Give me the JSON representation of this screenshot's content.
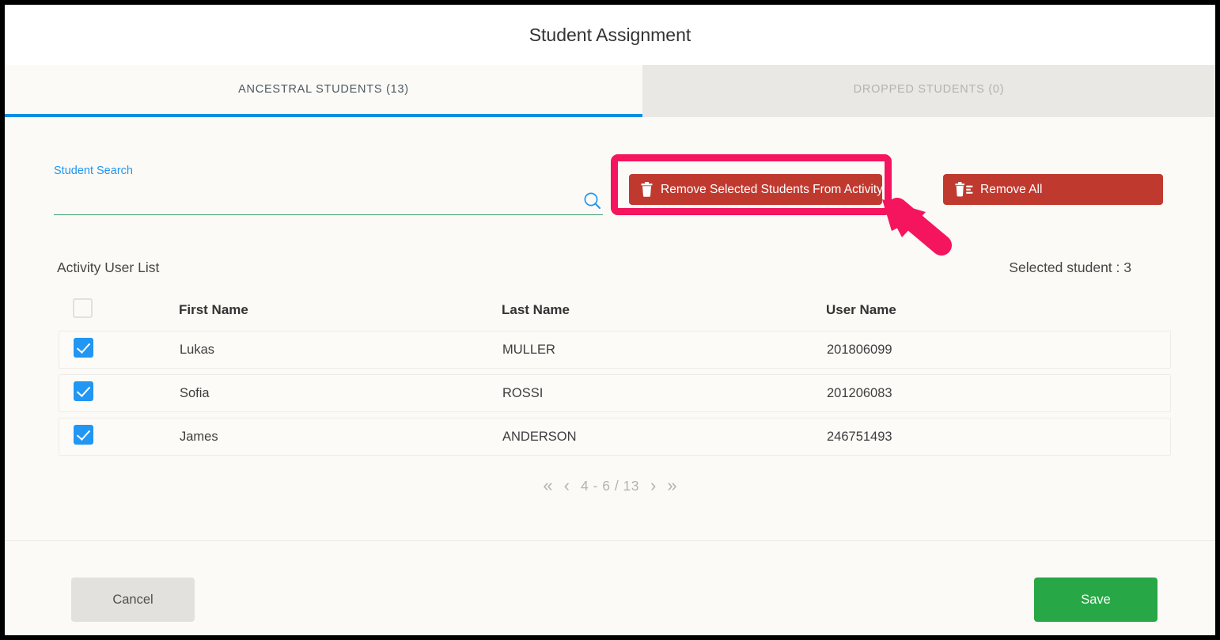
{
  "modal": {
    "title": "Student Assignment"
  },
  "tabs": [
    {
      "label": "ANCESTRAL STUDENTS (13)",
      "active": true
    },
    {
      "label": "DROPPED STUDENTS (0)",
      "active": false
    }
  ],
  "search": {
    "label": "Student Search",
    "value": "",
    "placeholder": "",
    "icon": "search-icon"
  },
  "actions": {
    "remove_selected_label": "Remove Selected Students From Activity",
    "remove_selected_icon": "trash-icon",
    "remove_all_label": "Remove All",
    "remove_all_icon": "trash-list-icon"
  },
  "list": {
    "title": "Activity User List",
    "selected_text": "Selected student : 3",
    "columns": [
      "",
      "First Name",
      "Last Name",
      "User Name"
    ],
    "header_checkbox_checked": false,
    "rows": [
      {
        "checked": true,
        "first_name": "Lukas",
        "last_name": "MULLER",
        "user_name": "201806099"
      },
      {
        "checked": true,
        "first_name": "Sofia",
        "last_name": "ROSSI",
        "user_name": "201206083"
      },
      {
        "checked": true,
        "first_name": "James",
        "last_name": "ANDERSON",
        "user_name": "246751493"
      }
    ]
  },
  "pagination": {
    "first_icon": "double-chevron-left-icon",
    "prev_icon": "chevron-left-icon",
    "range": "4 - 6 / 13",
    "next_icon": "chevron-right-icon",
    "last_icon": "double-chevron-right-icon"
  },
  "footer": {
    "cancel_label": "Cancel",
    "save_label": "Save"
  },
  "colors": {
    "accent_blue": "#008fe5",
    "checkbox_blue": "#2196f3",
    "danger_red": "#c0392f",
    "success_green": "#27a745",
    "annotation_pink": "#f4155e",
    "search_underline_green": "#3a9d6e",
    "page_background": "#fbfaf6"
  }
}
